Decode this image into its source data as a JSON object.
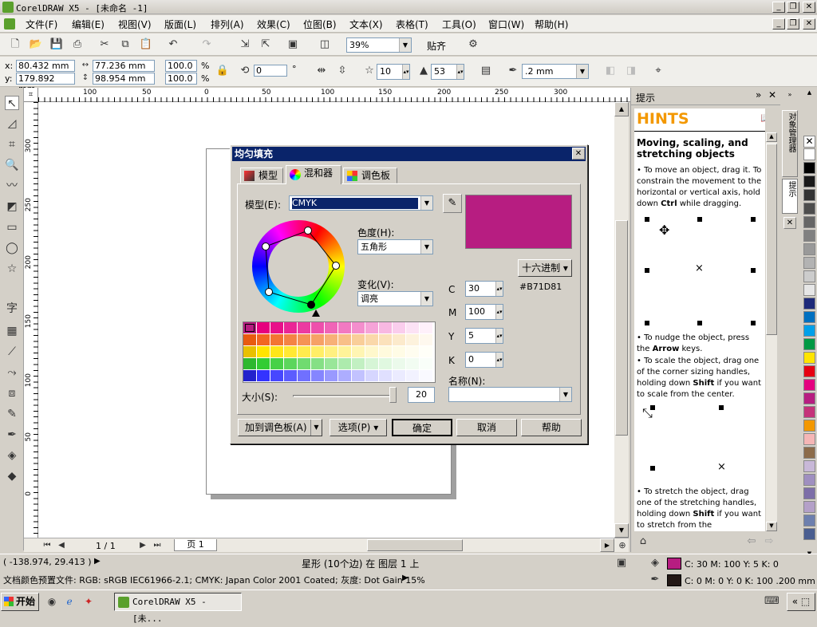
{
  "window": {
    "title": "CorelDRAW X5 - [未命名 -1]",
    "app_icon": "coreldraw-logo-icon"
  },
  "menubar": {
    "items": [
      "文件(F)",
      "编辑(E)",
      "视图(V)",
      "版面(L)",
      "排列(A)",
      "效果(C)",
      "位图(B)",
      "文本(X)",
      "表格(T)",
      "工具(O)",
      "窗口(W)",
      "帮助(H)"
    ]
  },
  "toolbar": {
    "zoom": "39%",
    "snap": "贴齐"
  },
  "propbar": {
    "x_label": "x:",
    "x": "80.432 mm",
    "y_label": "y:",
    "y": "179.892 mm",
    "w": "77.236 mm",
    "h": "98.954 mm",
    "sx": "100.0",
    "sy": "100.0",
    "pct": "%",
    "angle": "0",
    "deg": "°",
    "points": "10",
    "sharpness": "53",
    "outline": ".2 mm"
  },
  "rulers": {
    "h_ticks": [
      "100",
      "50",
      "0",
      "50",
      "100",
      "150",
      "200",
      "250",
      "300"
    ],
    "v_ticks": [
      "300",
      "250",
      "200",
      "150",
      "100",
      "50",
      "0"
    ],
    "unit": "毫米"
  },
  "page_nav": {
    "count": "1 / 1",
    "tab": "页 1"
  },
  "dialog": {
    "title": "均匀填充",
    "tabs": [
      "模型",
      "混和器",
      "调色板"
    ],
    "model_label": "模型(E):",
    "model_value": "CMYK",
    "hue_label": "色度(H):",
    "hue_value": "五角形",
    "variation_label": "变化(V):",
    "variation_value": "调亮",
    "hex_button": "十六进制",
    "hex_value": "#B71D81",
    "preview_color": "#b71d81",
    "cmyk": [
      {
        "k": "C",
        "v": "30"
      },
      {
        "k": "M",
        "v": "100"
      },
      {
        "k": "Y",
        "v": "5"
      },
      {
        "k": "K",
        "v": "0"
      }
    ],
    "size_label": "大小(S):",
    "size_value": "20",
    "name_label": "名称(N):",
    "name_value": "",
    "buttons": {
      "add": "加到调色板(A)",
      "options": "选项(P)",
      "ok": "确定",
      "cancel": "取消",
      "help": "帮助"
    },
    "grid_colors": [
      [
        "#b71d81",
        "#e6007e",
        "#e8108a",
        "#ea2596",
        "#ec3aa1",
        "#ee4fac",
        "#f064b7",
        "#f279c2",
        "#f48ecd",
        "#f6a3d8",
        "#f8b8e2",
        "#facded",
        "#fce2f5",
        "#fef0fa"
      ],
      [
        "#e85a10",
        "#f26522",
        "#f37433",
        "#f48344",
        "#f59255",
        "#f6a166",
        "#f7b077",
        "#f8bf88",
        "#f9ce99",
        "#fad8aa",
        "#fbe1bb",
        "#fceacc",
        "#fdf2dd",
        "#fef8ee"
      ],
      [
        "#e8c000",
        "#ffe400",
        "#ffe61a",
        "#ffe933",
        "#ffeb4d",
        "#ffee66",
        "#fff080",
        "#fff399",
        "#fff5b3",
        "#fff8cc",
        "#fffadd",
        "#fffce6",
        "#fffdf0",
        "#fffff8"
      ],
      [
        "#2eb82e",
        "#33cc33",
        "#47d147",
        "#5cd65c",
        "#70db70",
        "#85e085",
        "#99e699",
        "#adebad",
        "#c2f0c2",
        "#d6f5d6",
        "#e0f8e0",
        "#ebfaeb",
        "#f2fcf2",
        "#f9fef9"
      ],
      [
        "#2222cc",
        "#3333ff",
        "#4747ff",
        "#5c5cff",
        "#7070ff",
        "#8585ff",
        "#9999ff",
        "#adadff",
        "#c2c2ff",
        "#d6d6ff",
        "#e0e0ff",
        "#ebebff",
        "#f2f2ff",
        "#f9f9ff"
      ]
    ]
  },
  "hints": {
    "panel_title": "提示",
    "heading": "HINTS",
    "title": "Moving, scaling, and stretching objects",
    "b1": "To move an object, drag it. To constrain the movement to the horizontal or vertical axis, hold down ",
    "b1_key": "Ctrl",
    "b1_end": " while dragging.",
    "b2": "To nudge the object, press the ",
    "b2_key": "Arrow",
    "b2_end": " keys.",
    "b3": "To scale the object, drag one of the corner sizing handles, holding down ",
    "b3_key": "Shift",
    "b3_end": " if you want to scale from the center.",
    "b4": "To stretch the object, drag one of the stretching handles, holding down ",
    "b4_key": "Shift",
    "b4_end": " if you want to stretch from the",
    "side_tab1": "对象管理器",
    "side_tab2": "提示"
  },
  "palette": [
    "#ffffff",
    "#000000",
    "#1a1a1a",
    "#333333",
    "#4d4d4d",
    "#666666",
    "#808080",
    "#999999",
    "#b3b3b3",
    "#cccccc",
    "#e6e6e6",
    "#1e2a7a",
    "#0070c0",
    "#00a0e9",
    "#009944",
    "#ffe400",
    "#e60012",
    "#e4007f",
    "#b71d81",
    "#c4327a",
    "#f39800",
    "#f5b6b6",
    "#8c6b4a",
    "#c8b8d8",
    "#9f8fc0",
    "#7d6ea8",
    "#b4a0c8",
    "#6d7fae",
    "#4a5e90"
  ],
  "status": {
    "coords": "( -138.974, 29.413 )",
    "object": "星形 (10个边) 在 图层 1 上",
    "profile": "文档颜色预置文件: RGB: sRGB IEC61966-2.1; CMYK: Japan Color 2001 Coated; 灰度: Dot Gain 15%",
    "fill_info": "C: 30 M: 100 Y: 5 K: 0",
    "outline_info": "C: 0 M: 0 Y: 0 K: 100  .200 mm",
    "fill_swatch": "#b71d81",
    "outline_swatch": "#231815"
  },
  "taskbar": {
    "start": "开始",
    "task": "CorelDRAW X5 - [未..."
  }
}
